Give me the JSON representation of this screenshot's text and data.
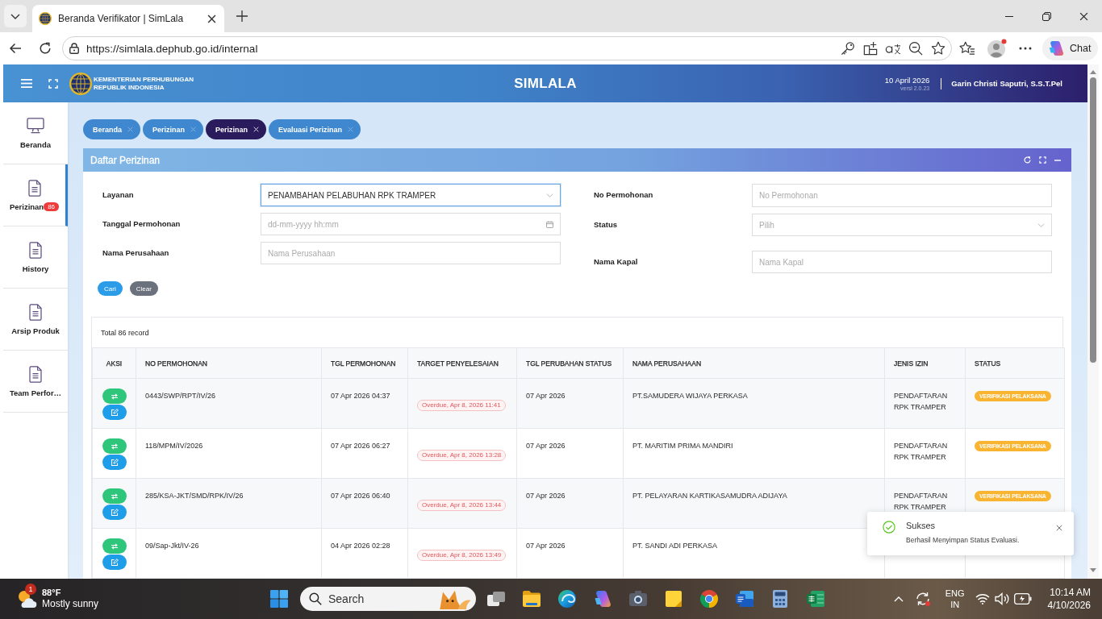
{
  "browser": {
    "tab_title": "Beranda Verifikator | SimLala",
    "url": "https://simlala.dephub.go.id/internal",
    "chat_label": "Chat"
  },
  "header": {
    "org_line_1": "KEMENTERIAN PERHUBUNGAN",
    "org_line_2": "REPUBLIK INDONESIA",
    "app_name": "SIMLALA",
    "date": "10 April 2026",
    "version": "versi 2.0.23",
    "user": "Garin Christi Saputri, S.S.T.Pel"
  },
  "sidebar": {
    "items": [
      {
        "label": "Beranda",
        "kind": "monitor",
        "selected": false
      },
      {
        "label": "Perizinan",
        "kind": "document",
        "selected": true,
        "badge": "86"
      },
      {
        "label": "History",
        "kind": "document",
        "selected": false
      },
      {
        "label": "Arsip Produk",
        "kind": "document",
        "selected": false
      },
      {
        "label": "Team Perfor…",
        "kind": "document",
        "selected": false
      }
    ]
  },
  "tabs": [
    {
      "label": "Beranda",
      "selected": false
    },
    {
      "label": "Perizinan",
      "selected": false
    },
    {
      "label": "Perizinan",
      "selected": true
    },
    {
      "label": "Evaluasi Perizinan",
      "selected": false
    }
  ],
  "panel": {
    "title": "Daftar Perizinan"
  },
  "filters": {
    "left": [
      {
        "label": "Layanan",
        "kind": "select",
        "value": "PENAMBAHAN PELABUHAN RPK TRAMPER",
        "focused": true
      },
      {
        "label": "Tanggal Permohonan",
        "kind": "date",
        "placeholder": "dd-mm-yyyy hh:mm",
        "focused": false
      },
      {
        "label": "Nama Perusahaan",
        "kind": "text",
        "placeholder": "Nama Perusahaan",
        "focused": false
      }
    ],
    "right": [
      {
        "label": "No Permohonan",
        "kind": "text",
        "placeholder": "No Permohonan",
        "focused": false
      },
      {
        "label": "Status",
        "kind": "select",
        "placeholder": "Pilih",
        "focused": false
      },
      {
        "label": "Nama Kapal",
        "kind": "text",
        "placeholder": "Nama Kapal",
        "focused": false
      }
    ]
  },
  "buttons": [
    {
      "label": "Cari",
      "kind": "primary"
    },
    {
      "label": "Clear",
      "kind": "secondary"
    }
  ],
  "table": {
    "total": "Total 86 record",
    "columns": [
      "AKSI",
      "NO PERMOHONAN",
      "TGL PERMOHONAN",
      "TARGET PENYELESAIAN",
      "TGL PERUBAHAN STATUS",
      "NAMA PERUSAHAAN",
      "JENIS IZIN",
      "STATUS"
    ],
    "rows": [
      {
        "no_permohonan": "0443/SWP/RPT/IV/26",
        "tgl_permohonan": "07 Apr 2026 04:37",
        "target_penyelesaian": "Overdue, Apr 8, 2026 11:41",
        "tgl_perubahan_status": "07 Apr 2026",
        "nama_perusahaan": "PT.SAMUDERA WIJAYA PERKASA",
        "jenis_izin": "PENDAFTARAN RPK TRAMPER",
        "status": "VERIFIKASI PELAKSANA"
      },
      {
        "no_permohonan": "118/MPM/IV/2026",
        "tgl_permohonan": "07 Apr 2026 06:27",
        "target_penyelesaian": "Overdue, Apr 8, 2026 13:28",
        "tgl_perubahan_status": "07 Apr 2026",
        "nama_perusahaan": "PT. MARITIM PRIMA MANDIRI",
        "jenis_izin": "PENDAFTARAN RPK TRAMPER",
        "status": "VERIFIKASI PELAKSANA"
      },
      {
        "no_permohonan": "285/KSA-JKT/SMD/RPK/IV/26",
        "tgl_permohonan": "07 Apr 2026 06:40",
        "target_penyelesaian": "Overdue, Apr 8, 2026 13:44",
        "tgl_perubahan_status": "07 Apr 2026",
        "nama_perusahaan": "PT. PELAYARAN KARTIKASAMUDRA ADIJAYA",
        "jenis_izin": "PENDAFTARAN RPK TRAMPER",
        "status": "VERIFIKASI PELAKSANA"
      },
      {
        "no_permohonan": "09/Sap-Jkt/IV-26",
        "tgl_permohonan": "04 Apr 2026 02:28",
        "target_penyelesaian": "Overdue, Apr 8, 2026 13:49",
        "tgl_perubahan_status": "07 Apr 2026",
        "nama_perusahaan": "PT. SANDI ADI PERKASA"
      }
    ]
  },
  "toast": {
    "title": "Sukses",
    "message": "Berhasil Menyimpan Status Evaluasi."
  },
  "taskbar": {
    "notification_count": "1",
    "temperature": "88°F",
    "condition": "Mostly sunny",
    "search_placeholder": "Search",
    "language": "ENG",
    "region": "IN",
    "time": "10:14 AM",
    "date": "4/10/2026"
  }
}
